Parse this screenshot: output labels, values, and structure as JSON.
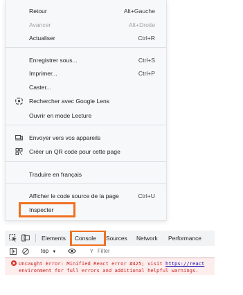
{
  "context_menu": {
    "items": [
      {
        "label": "Retour",
        "shortcut": "Alt+Gauche",
        "disabled": false
      },
      {
        "label": "Avancer",
        "shortcut": "Alt+Droite",
        "disabled": true
      },
      {
        "label": "Actualiser",
        "shortcut": "Ctrl+R",
        "disabled": false
      },
      {
        "label": "Enregistrer sous...",
        "shortcut": "Ctrl+S",
        "disabled": false
      },
      {
        "label": "Imprimer...",
        "shortcut": "Ctrl+P",
        "disabled": false
      },
      {
        "label": "Caster...",
        "shortcut": "",
        "disabled": false
      },
      {
        "label": "Rechercher avec Google Lens",
        "shortcut": "",
        "icon": "google-lens-icon"
      },
      {
        "label": "Ouvrir en mode Lecture",
        "shortcut": ""
      },
      {
        "label": "Envoyer vers vos appareils",
        "shortcut": "",
        "icon": "devices-icon"
      },
      {
        "label": "Créer un QR code pour cette page",
        "shortcut": "",
        "icon": "qr-code-icon"
      },
      {
        "label": "Traduire en français",
        "shortcut": ""
      },
      {
        "label": "Afficher le code source de la page",
        "shortcut": "Ctrl+U"
      },
      {
        "label": "Inspecter",
        "shortcut": "",
        "highlighted": true
      }
    ]
  },
  "devtools": {
    "tabs": [
      "Elements",
      "Console",
      "Sources",
      "Network",
      "Performance"
    ],
    "active_tab": "Console",
    "context_selector": "top",
    "filter_placeholder": "Filter",
    "error": {
      "line1_prefix": "Uncaught Error: Minified React error #425; visit ",
      "link": "https://react",
      "line2": "environment for full errors and additional helpful warnings."
    }
  },
  "colors": {
    "highlight": "#f07020",
    "error_text": "#c5221f",
    "error_bg": "#fdeeee"
  }
}
